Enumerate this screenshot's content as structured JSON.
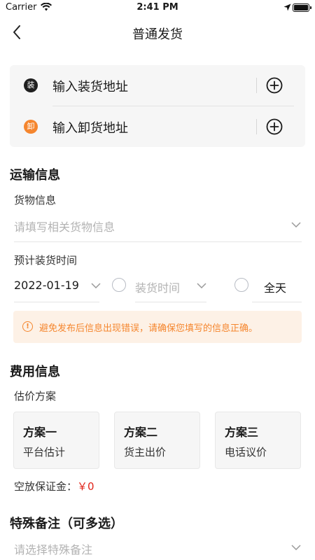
{
  "status_bar": {
    "carrier": "Carrier",
    "time": "2:41 PM"
  },
  "header": {
    "title": "普通发货"
  },
  "addresses": [
    {
      "badge": "装",
      "badge_color": "#1f1f1f",
      "label": "输入装货地址"
    },
    {
      "badge": "卸",
      "badge_color": "#f5862e",
      "label": "输入卸货地址"
    }
  ],
  "transport": {
    "title": "运输信息",
    "goods_label": "货物信息",
    "goods_placeholder": "请填写相关货物信息",
    "time_label": "预计装货时间",
    "date_value": "2022-01-19",
    "time_placeholder": "装货时间",
    "all_day_label": "全天"
  },
  "notice": {
    "text": "避免发布后信息出现错误，请确保您填写的信息正确。",
    "color": "#f5862e"
  },
  "fees": {
    "title": "费用信息",
    "plan_label": "估价方案",
    "plans": [
      {
        "name": "方案一",
        "desc": "平台估计"
      },
      {
        "name": "方案二",
        "desc": "货主出价"
      },
      {
        "name": "方案三",
        "desc": "电话议价"
      }
    ],
    "deposit_label": "空放保证金：",
    "deposit_value": "￥0"
  },
  "remarks": {
    "title": "特殊备注（可多选）",
    "placeholder": "请选择特殊备注"
  }
}
